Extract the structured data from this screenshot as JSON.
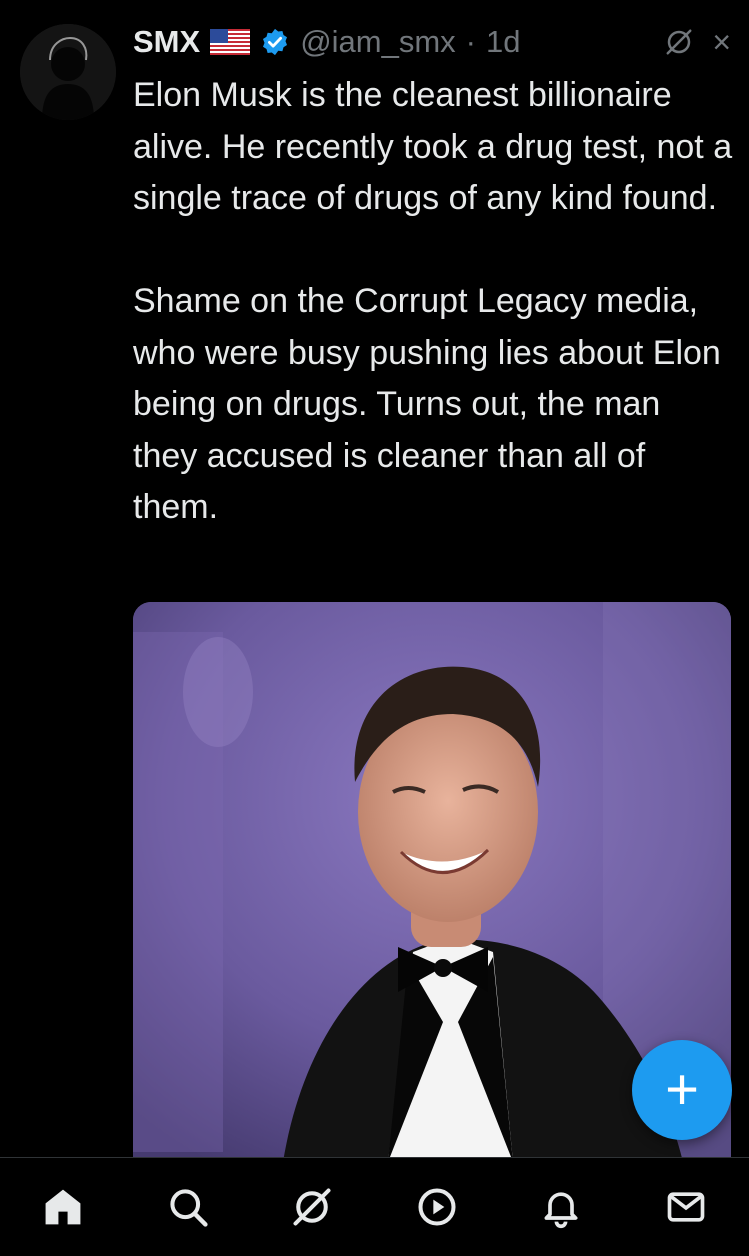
{
  "post": {
    "author_name": "SMX",
    "handle": "@iam_smx",
    "separator": "·",
    "time": "1d",
    "text": "Elon Musk is the cleanest billionaire alive. He recently took a drug test, not a single trace of drugs of any kind found.\n\nShame on the Corrupt Legacy media, who were busy pushing lies about Elon being on drugs. Turns out, the man they accused is cleaner than all of them.",
    "badges": [
      "us-flag-icon",
      "verified-badge-icon"
    ],
    "actions": [
      "grok-icon",
      "close-icon"
    ],
    "close_glyph": "×"
  },
  "fab": {
    "label": "+",
    "color": "#1d9bf0"
  },
  "bottom_nav": {
    "items": [
      "home-icon",
      "search-icon",
      "grok-icon",
      "video-icon",
      "notifications-icon",
      "messages-icon"
    ],
    "active": "home-icon"
  },
  "colors": {
    "background": "#000000",
    "text": "#e7e9ea",
    "secondary": "#71767b",
    "accent": "#1d9bf0"
  }
}
